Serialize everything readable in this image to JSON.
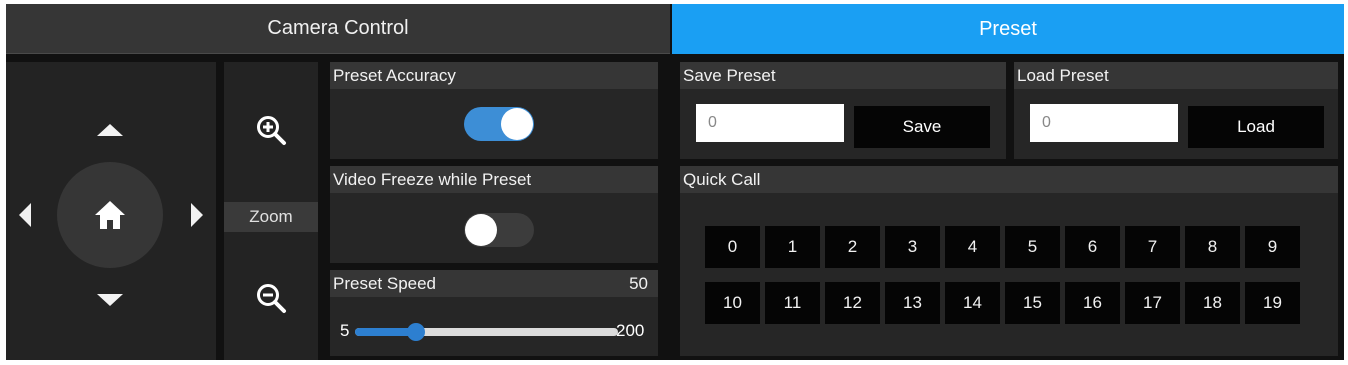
{
  "tabs": [
    {
      "label": "Camera Control",
      "active": false
    },
    {
      "label": "Preset",
      "active": true
    }
  ],
  "zoom": {
    "label": "Zoom"
  },
  "settings": {
    "preset_accuracy": {
      "label": "Preset Accuracy",
      "on": true
    },
    "video_freeze": {
      "label": "Video Freeze while Preset",
      "on": false
    },
    "preset_speed": {
      "label": "Preset Speed",
      "value": 50,
      "min": "5",
      "max": "200",
      "value_text": "50"
    }
  },
  "save_preset": {
    "header": "Save Preset",
    "value": "0",
    "button": "Save"
  },
  "load_preset": {
    "header": "Load Preset",
    "value": "0",
    "button": "Load"
  },
  "quick_call": {
    "header": "Quick Call",
    "buttons": [
      "0",
      "1",
      "2",
      "3",
      "4",
      "5",
      "6",
      "7",
      "8",
      "9",
      "10",
      "11",
      "12",
      "13",
      "14",
      "15",
      "16",
      "17",
      "18",
      "19"
    ]
  },
  "colors": {
    "accent": "#1a9ff3",
    "toggle_on": "#3d8ed6",
    "slider": "#2d7fd0"
  }
}
